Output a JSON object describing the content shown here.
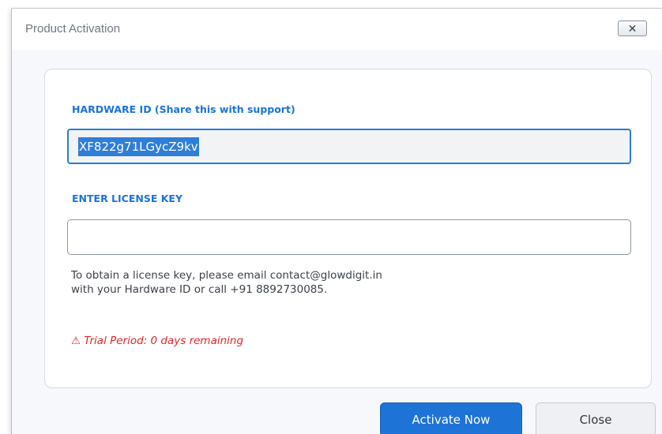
{
  "window": {
    "title": "Product Activation",
    "close_glyph": "✕"
  },
  "hardware": {
    "label": "HARDWARE ID (Share this with support)",
    "value": "XF822g71LGycZ9kv"
  },
  "license": {
    "label": "ENTER LICENSE KEY",
    "value": "",
    "placeholder": ""
  },
  "info": {
    "line1": "To obtain a license key, please email contact@glowdigit.in",
    "line2": "with your Hardware ID or call +91 8892730085."
  },
  "trial": {
    "text": "⚠ Trial Period: 0 days remaining"
  },
  "buttons": {
    "activate_label": "Activate Now",
    "close_label": "Close"
  },
  "colors": {
    "accent": "#1a73d9",
    "warning": "#e0262b",
    "primary_button": "#1e73d6"
  }
}
